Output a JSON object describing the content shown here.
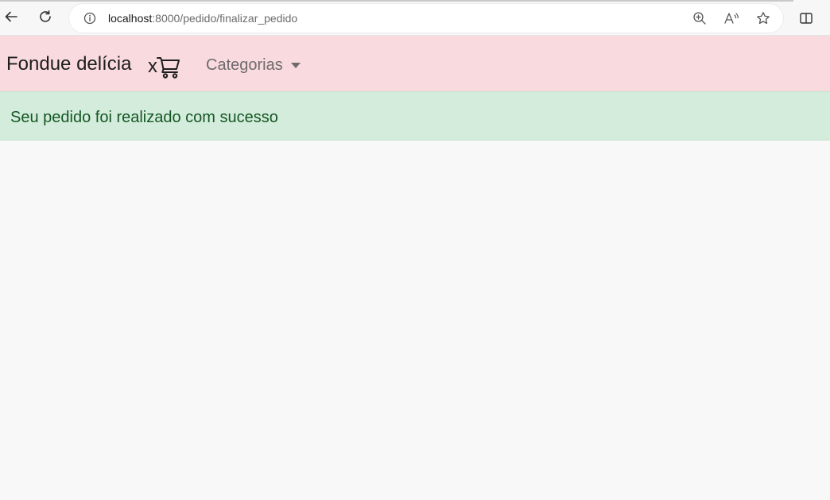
{
  "browser": {
    "url_host": "localhost",
    "url_rest": ":8000/pedido/finalizar_pedido",
    "icons": {
      "back": "arrow-left-icon",
      "reload": "reload-icon",
      "info": "info-icon",
      "zoom": "zoom-in-icon",
      "read_aloud": "read-aloud-icon",
      "favorite": "star-icon",
      "split": "split-screen-icon"
    }
  },
  "navbar": {
    "brand": "Fondue delícia",
    "cart_count": "x",
    "cart_icon": "cart-icon",
    "dropdown_label": "Categorias",
    "background": "#f8dadf"
  },
  "alert": {
    "message": "Seu pedido foi realizado com sucesso",
    "background": "#d4ecdc",
    "text_color": "#155724"
  }
}
